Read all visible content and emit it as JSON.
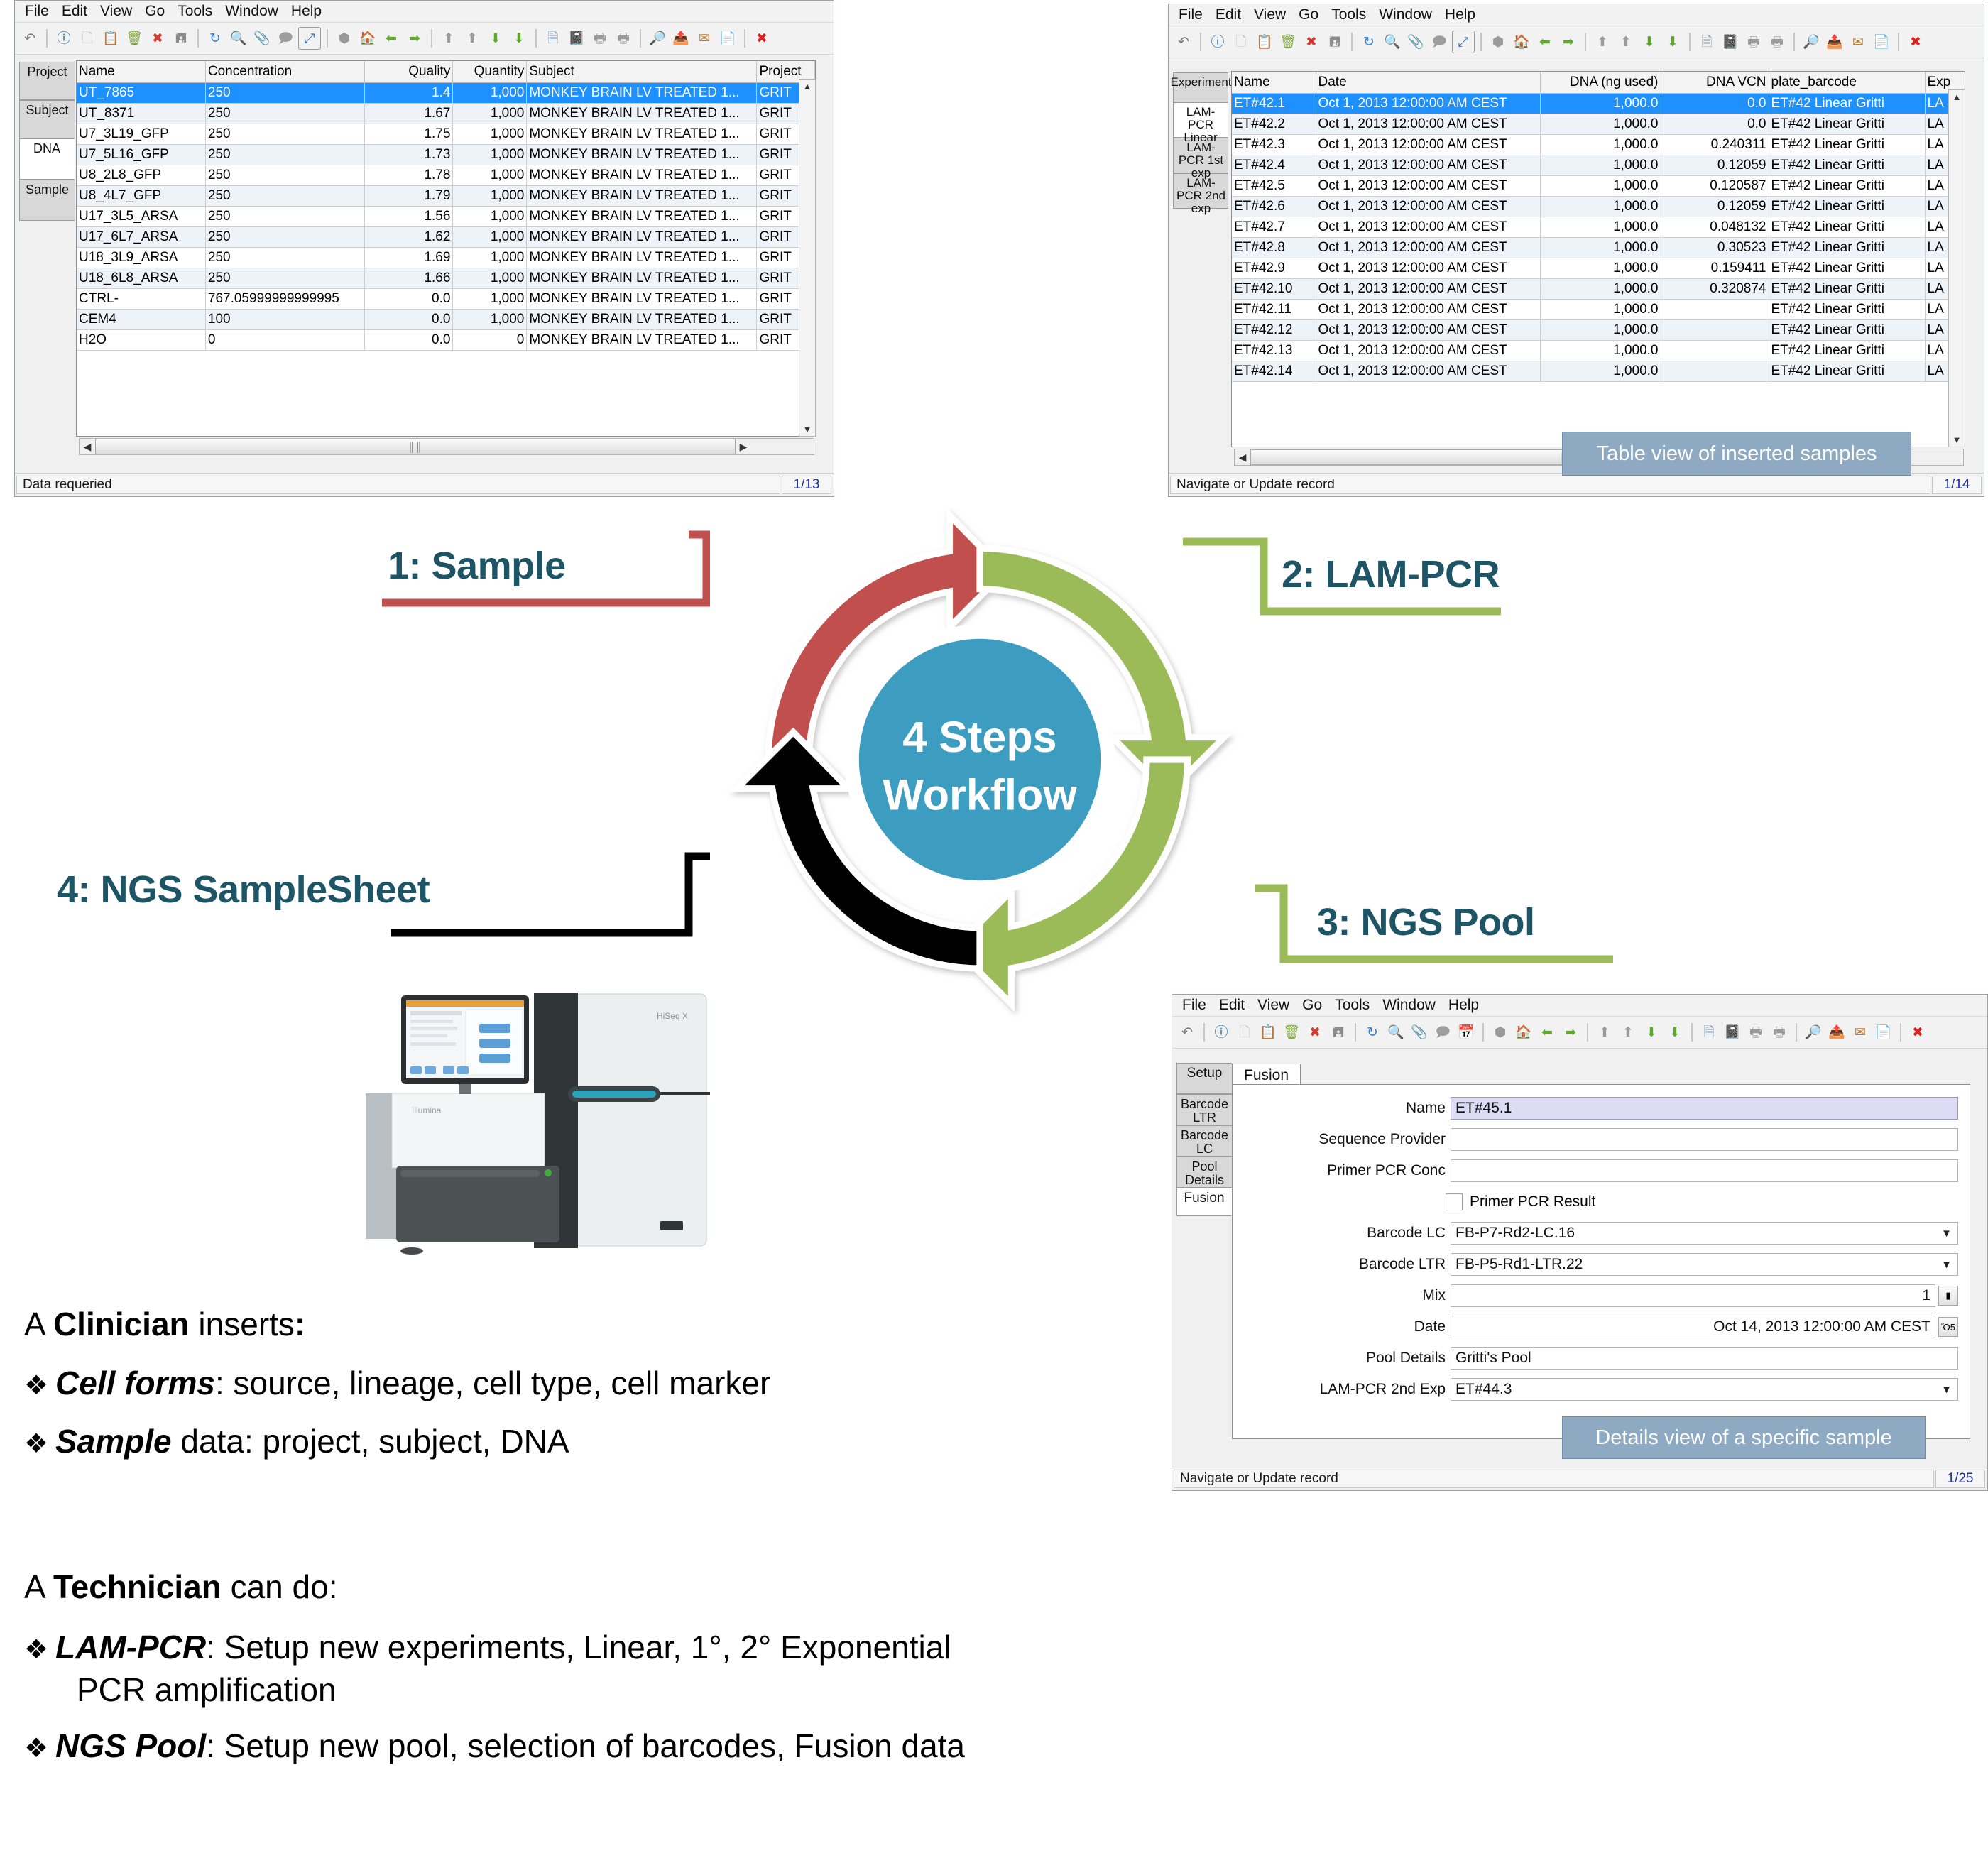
{
  "colors": {
    "label_teal": "#1d5466",
    "red": "#c0504d",
    "green": "#9bbb59",
    "black": "#000000",
    "ring_center": "#3d9dc0",
    "callout_bg": "#8ea9c2",
    "row_selected": "#1e90ff"
  },
  "menu": {
    "items": [
      "File",
      "Edit",
      "View",
      "Go",
      "Tools",
      "Window",
      "Help"
    ]
  },
  "toolbar": {
    "icons": [
      "undo-icon",
      "help-icon",
      "new-document-icon",
      "copy-document-icon",
      "recycle-bin-icon",
      "delete-x-icon",
      "save-icon",
      "refresh-icon",
      "search-icon",
      "attachment-icon",
      "comment-icon",
      "fullscreen-icon",
      "stop-icon",
      "home-icon",
      "back-arrow-icon",
      "forward-arrow-icon",
      "first-record-icon",
      "previous-record-icon",
      "next-record-icon",
      "last-record-icon",
      "report-icon",
      "book-icon",
      "print-gray-icon",
      "print-gray2-icon",
      "search-replace-icon",
      "export-icon",
      "mail-attach-icon",
      "clipboard-icon",
      "close-red-icon"
    ]
  },
  "sample_window": {
    "tabs": [
      {
        "label": "Project",
        "selected": false
      },
      {
        "label": "Subject",
        "selected": false
      },
      {
        "label": "DNA",
        "selected": true
      },
      {
        "label": "Sample",
        "selected": false
      }
    ],
    "columns": [
      "Name",
      "Concentration",
      "Quality",
      "Quantity",
      "Subject",
      "Project"
    ],
    "rows": [
      {
        "name": "UT_7865",
        "concentration": "250",
        "quality": "1.4",
        "quantity": "1,000",
        "subject": "MONKEY BRAIN LV TREATED 1...",
        "project": "GRIT",
        "selected": true
      },
      {
        "name": "UT_8371",
        "concentration": "250",
        "quality": "1.67",
        "quantity": "1,000",
        "subject": "MONKEY BRAIN LV TREATED 1...",
        "project": "GRIT",
        "selected": false
      },
      {
        "name": "U7_3L19_GFP",
        "concentration": "250",
        "quality": "1.75",
        "quantity": "1,000",
        "subject": "MONKEY BRAIN LV TREATED 1...",
        "project": "GRIT",
        "selected": false
      },
      {
        "name": "U7_5L16_GFP",
        "concentration": "250",
        "quality": "1.73",
        "quantity": "1,000",
        "subject": "MONKEY BRAIN LV TREATED 1...",
        "project": "GRIT",
        "selected": false
      },
      {
        "name": "U8_2L8_GFP",
        "concentration": "250",
        "quality": "1.78",
        "quantity": "1,000",
        "subject": "MONKEY BRAIN LV TREATED 1...",
        "project": "GRIT",
        "selected": false
      },
      {
        "name": "U8_4L7_GFP",
        "concentration": "250",
        "quality": "1.79",
        "quantity": "1,000",
        "subject": "MONKEY BRAIN LV TREATED 1...",
        "project": "GRIT",
        "selected": false
      },
      {
        "name": "U17_3L5_ARSA",
        "concentration": "250",
        "quality": "1.56",
        "quantity": "1,000",
        "subject": "MONKEY BRAIN LV TREATED 1...",
        "project": "GRIT",
        "selected": false
      },
      {
        "name": "U17_6L7_ARSA",
        "concentration": "250",
        "quality": "1.62",
        "quantity": "1,000",
        "subject": "MONKEY BRAIN LV TREATED 1...",
        "project": "GRIT",
        "selected": false
      },
      {
        "name": "U18_3L9_ARSA",
        "concentration": "250",
        "quality": "1.69",
        "quantity": "1,000",
        "subject": "MONKEY BRAIN LV TREATED 1...",
        "project": "GRIT",
        "selected": false
      },
      {
        "name": "U18_6L8_ARSA",
        "concentration": "250",
        "quality": "1.66",
        "quantity": "1,000",
        "subject": "MONKEY BRAIN LV TREATED 1...",
        "project": "GRIT",
        "selected": false
      },
      {
        "name": "CTRL-",
        "concentration": "767.05999999999995",
        "quality": "0.0",
        "quantity": "1,000",
        "subject": "MONKEY BRAIN LV TREATED 1...",
        "project": "GRIT",
        "selected": false
      },
      {
        "name": "CEM4",
        "concentration": "100",
        "quality": "0.0",
        "quantity": "1,000",
        "subject": "MONKEY BRAIN LV TREATED 1...",
        "project": "GRIT",
        "selected": false
      },
      {
        "name": "H2O",
        "concentration": "0",
        "quality": "0.0",
        "quantity": "0",
        "subject": "MONKEY BRAIN LV TREATED 1...",
        "project": "GRIT",
        "selected": false
      }
    ],
    "status": "Data requeried",
    "record_counter": "1/13"
  },
  "lampcr_window": {
    "tabs": [
      {
        "label": "Experiment",
        "selected": false
      },
      {
        "label": "LAM-PCR Linear",
        "selected": true
      },
      {
        "label": "LAM-PCR 1st exp",
        "selected": false
      },
      {
        "label": "LAM-PCR 2nd exp",
        "selected": false
      }
    ],
    "columns": [
      "Name",
      "Date",
      "DNA (ng used)",
      "DNA VCN",
      "plate_barcode",
      "Exp"
    ],
    "rows": [
      {
        "name": "ET#42.1",
        "date": "Oct 1, 2013 12:00:00 AM CEST",
        "dna": "1,000.0",
        "vcn": "0.0",
        "barcode": "ET#42 Linear Gritti",
        "exp": "LA",
        "selected": true
      },
      {
        "name": "ET#42.2",
        "date": "Oct 1, 2013 12:00:00 AM CEST",
        "dna": "1,000.0",
        "vcn": "0.0",
        "barcode": "ET#42 Linear Gritti",
        "exp": "LA",
        "selected": false
      },
      {
        "name": "ET#42.3",
        "date": "Oct 1, 2013 12:00:00 AM CEST",
        "dna": "1,000.0",
        "vcn": "0.240311",
        "barcode": "ET#42 Linear Gritti",
        "exp": "LA",
        "selected": false
      },
      {
        "name": "ET#42.4",
        "date": "Oct 1, 2013 12:00:00 AM CEST",
        "dna": "1,000.0",
        "vcn": "0.12059",
        "barcode": "ET#42 Linear Gritti",
        "exp": "LA",
        "selected": false
      },
      {
        "name": "ET#42.5",
        "date": "Oct 1, 2013 12:00:00 AM CEST",
        "dna": "1,000.0",
        "vcn": "0.120587",
        "barcode": "ET#42 Linear Gritti",
        "exp": "LA",
        "selected": false
      },
      {
        "name": "ET#42.6",
        "date": "Oct 1, 2013 12:00:00 AM CEST",
        "dna": "1,000.0",
        "vcn": "0.12059",
        "barcode": "ET#42 Linear Gritti",
        "exp": "LA",
        "selected": false
      },
      {
        "name": "ET#42.7",
        "date": "Oct 1, 2013 12:00:00 AM CEST",
        "dna": "1,000.0",
        "vcn": "0.048132",
        "barcode": "ET#42 Linear Gritti",
        "exp": "LA",
        "selected": false
      },
      {
        "name": "ET#42.8",
        "date": "Oct 1, 2013 12:00:00 AM CEST",
        "dna": "1,000.0",
        "vcn": "0.30523",
        "barcode": "ET#42 Linear Gritti",
        "exp": "LA",
        "selected": false
      },
      {
        "name": "ET#42.9",
        "date": "Oct 1, 2013 12:00:00 AM CEST",
        "dna": "1,000.0",
        "vcn": "0.159411",
        "barcode": "ET#42 Linear Gritti",
        "exp": "LA",
        "selected": false
      },
      {
        "name": "ET#42.10",
        "date": "Oct 1, 2013 12:00:00 AM CEST",
        "dna": "1,000.0",
        "vcn": "0.320874",
        "barcode": "ET#42 Linear Gritti",
        "exp": "LA",
        "selected": false
      },
      {
        "name": "ET#42.11",
        "date": "Oct 1, 2013 12:00:00 AM CEST",
        "dna": "1,000.0",
        "vcn": "",
        "barcode": "ET#42 Linear Gritti",
        "exp": "LA",
        "selected": false
      },
      {
        "name": "ET#42.12",
        "date": "Oct 1, 2013 12:00:00 AM CEST",
        "dna": "1,000.0",
        "vcn": "",
        "barcode": "ET#42 Linear Gritti",
        "exp": "LA",
        "selected": false
      },
      {
        "name": "ET#42.13",
        "date": "Oct 1, 2013 12:00:00 AM CEST",
        "dna": "1,000.0",
        "vcn": "",
        "barcode": "ET#42 Linear Gritti",
        "exp": "LA",
        "selected": false
      },
      {
        "name": "ET#42.14",
        "date": "Oct 1, 2013 12:00:00 AM CEST",
        "dna": "1,000.0",
        "vcn": "",
        "barcode": "ET#42 Linear Gritti",
        "exp": "LA",
        "selected": false
      }
    ],
    "callout": "Table view of inserted samples",
    "status": "Navigate or Update record",
    "record_counter": "1/14"
  },
  "pool_window": {
    "tabs": [
      {
        "label": "Setup",
        "selected": false
      },
      {
        "label": "Barcode LTR",
        "selected": false
      },
      {
        "label": "Barcode LC",
        "selected": false
      },
      {
        "label": "Pool Details",
        "selected": false
      },
      {
        "label": "Fusion",
        "selected": true
      }
    ],
    "content_tab": "Fusion",
    "fields": [
      {
        "label": "Name",
        "value": "ET#45.1",
        "type": "text",
        "highlight": true
      },
      {
        "label": "Sequence Provider",
        "value": "",
        "type": "text",
        "highlight": false
      },
      {
        "label": "Primer PCR Conc",
        "value": "",
        "type": "text",
        "highlight": false
      },
      {
        "label": "Primer PCR Result",
        "value": "",
        "type": "checkbox",
        "checked": false
      },
      {
        "label": "Barcode LC",
        "value": "FB-P7-Rd2-LC.16",
        "type": "combo"
      },
      {
        "label": "Barcode LTR",
        "value": "FB-P5-Rd1-LTR.22",
        "type": "combo"
      },
      {
        "label": "Mix",
        "value": "1",
        "type": "spinner"
      },
      {
        "label": "Date",
        "value": "Oct 14, 2013 12:00:00 AM CEST",
        "type": "date"
      },
      {
        "label": "Pool Details",
        "value": "Gritti's Pool",
        "type": "text",
        "highlight": false
      },
      {
        "label": "LAM-PCR 2nd Exp",
        "value": "ET#44.3",
        "type": "combo"
      }
    ],
    "callout": "Details view of a specific sample",
    "status": "Navigate or Update record",
    "record_counter": "1/25"
  },
  "workflow": {
    "center_line1": "4 Steps",
    "center_line2": "Workflow",
    "steps": [
      {
        "num": "1",
        "label": "1: Sample",
        "color": "#c0504d"
      },
      {
        "num": "2",
        "label": "2: LAM-PCR",
        "color": "#9bbb59"
      },
      {
        "num": "3",
        "label": "3: NGS Pool",
        "color": "#9bbb59"
      },
      {
        "num": "4",
        "label": "4: NGS SampleSheet",
        "color": "#000000"
      }
    ]
  },
  "sequencer": {
    "brand": "Illumina",
    "model": "HiSeq X"
  },
  "prose": {
    "clinician_heading_a": "A ",
    "clinician_heading_b": "Clinician",
    "clinician_heading_c": " inserts",
    "clinician_heading_d": ":",
    "clinician_bullets": [
      {
        "strong": "Cell forms",
        "rest": ": source, lineage, cell type, cell marker"
      },
      {
        "strong": "Sample",
        "rest": " data: project, subject, DNA"
      }
    ],
    "technician_heading_a": "A ",
    "technician_heading_b": "Technician",
    "technician_heading_c": " can do:",
    "technician_bullets": [
      {
        "strong": "LAM-PCR",
        "rest": ": Setup new experiments, Linear, 1°, 2° Exponential",
        "cont": "PCR amplification"
      },
      {
        "strong": "NGS Pool",
        "rest": ": Setup new pool, selection of barcodes, Fusion data",
        "cont": ""
      }
    ],
    "bullet_glyph": "❖"
  }
}
